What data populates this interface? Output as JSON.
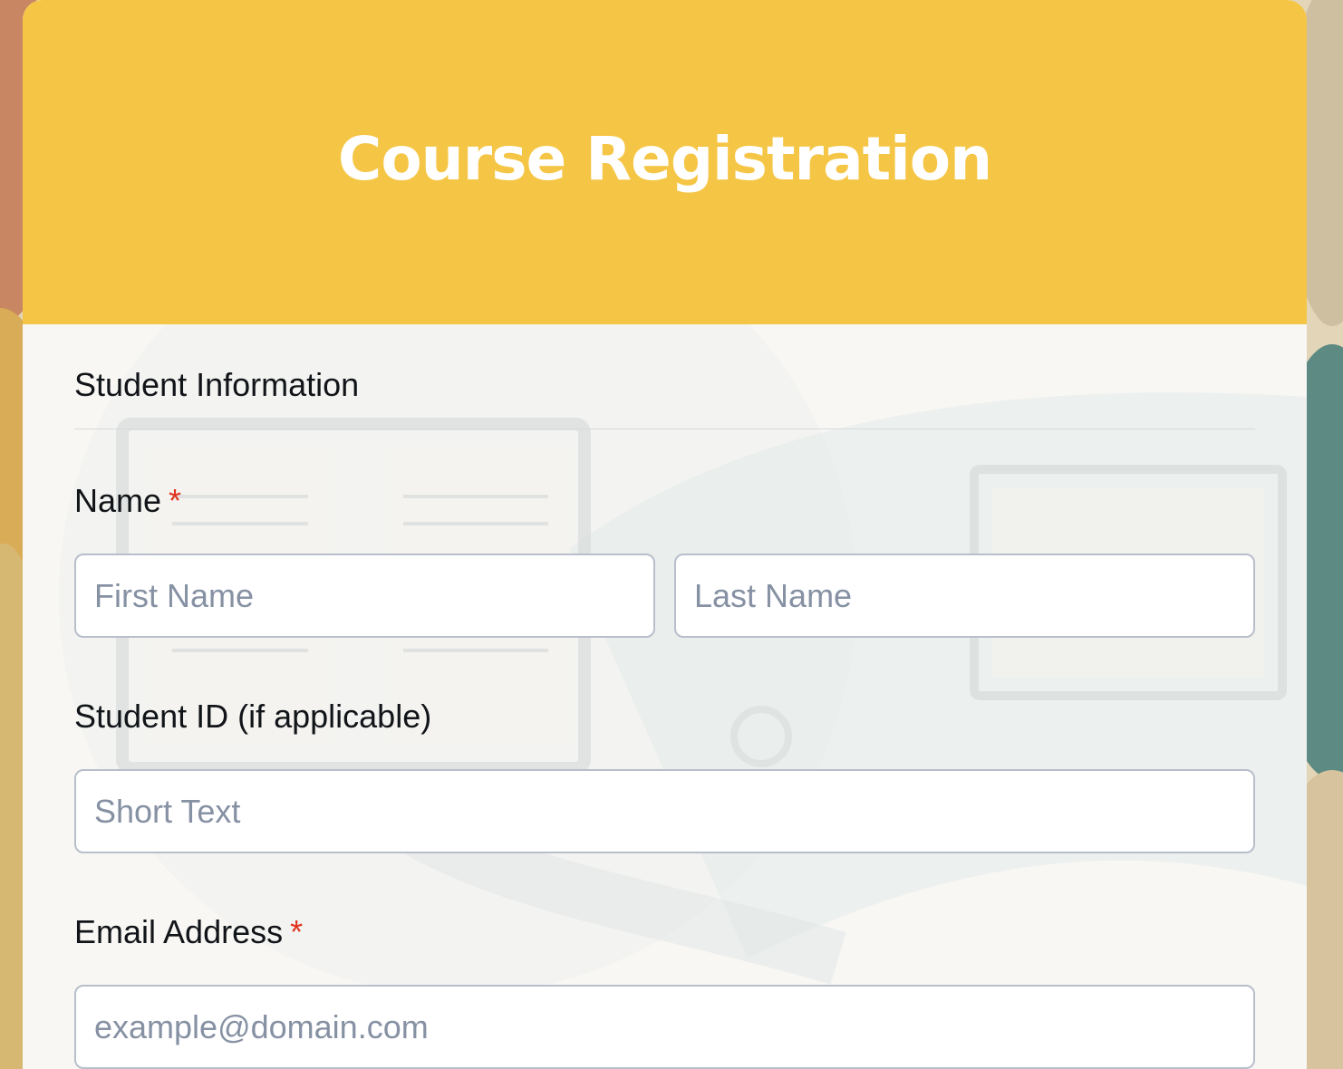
{
  "form": {
    "title": "Course Registration",
    "section_title": "Student Information",
    "fields": {
      "name": {
        "label": "Name",
        "required_marker": "*",
        "first_placeholder": "First Name",
        "last_placeholder": "Last Name"
      },
      "student_id": {
        "label": "Student ID (if applicable)",
        "placeholder": "Short Text"
      },
      "email": {
        "label": "Email Address",
        "required_marker": "*",
        "placeholder": "example@domain.com"
      }
    }
  },
  "colors": {
    "header": "#f5c646",
    "required": "#e0331f"
  }
}
